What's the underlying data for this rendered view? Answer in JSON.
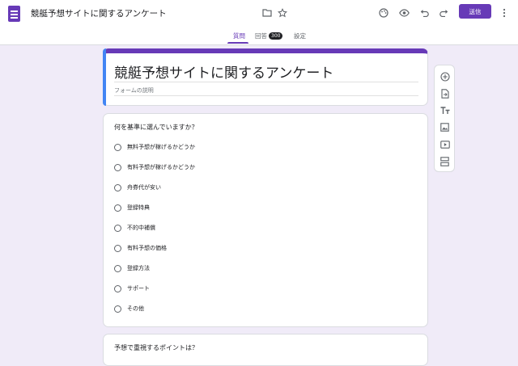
{
  "header": {
    "title": "競艇予想サイトに関するアンケート",
    "send_label": "送信",
    "icons": [
      "folder-icon",
      "star-icon",
      "palette-icon",
      "preview-eye-icon",
      "undo-icon",
      "redo-icon",
      "more-vert-icon"
    ]
  },
  "tabs": [
    {
      "label": "質問",
      "active": true
    },
    {
      "label": "回答",
      "badge": "300"
    },
    {
      "label": "設定"
    }
  ],
  "form": {
    "title": "競艇予想サイトに関するアンケート",
    "description_placeholder": "フォームの説明"
  },
  "questions": [
    {
      "title": "何を基準に選んでいますか？",
      "options": [
        "無料予想が稼げるかどうか",
        "有料予想が稼げるかどうか",
        "舟券代が安い",
        "登録特典",
        "不的中補償",
        "有料予想の価格",
        "登録方法",
        "サポート",
        "その他"
      ]
    },
    {
      "title": "予想で重視するポイントは？",
      "options": []
    }
  ],
  "toolbar": [
    "add-question-icon",
    "import-question-icon",
    "add-title-icon",
    "add-image-icon",
    "add-video-icon",
    "add-section-icon"
  ],
  "colors": {
    "accent": "#673ab7",
    "background": "#f0ebf8",
    "title_bar": "#4285f4"
  }
}
